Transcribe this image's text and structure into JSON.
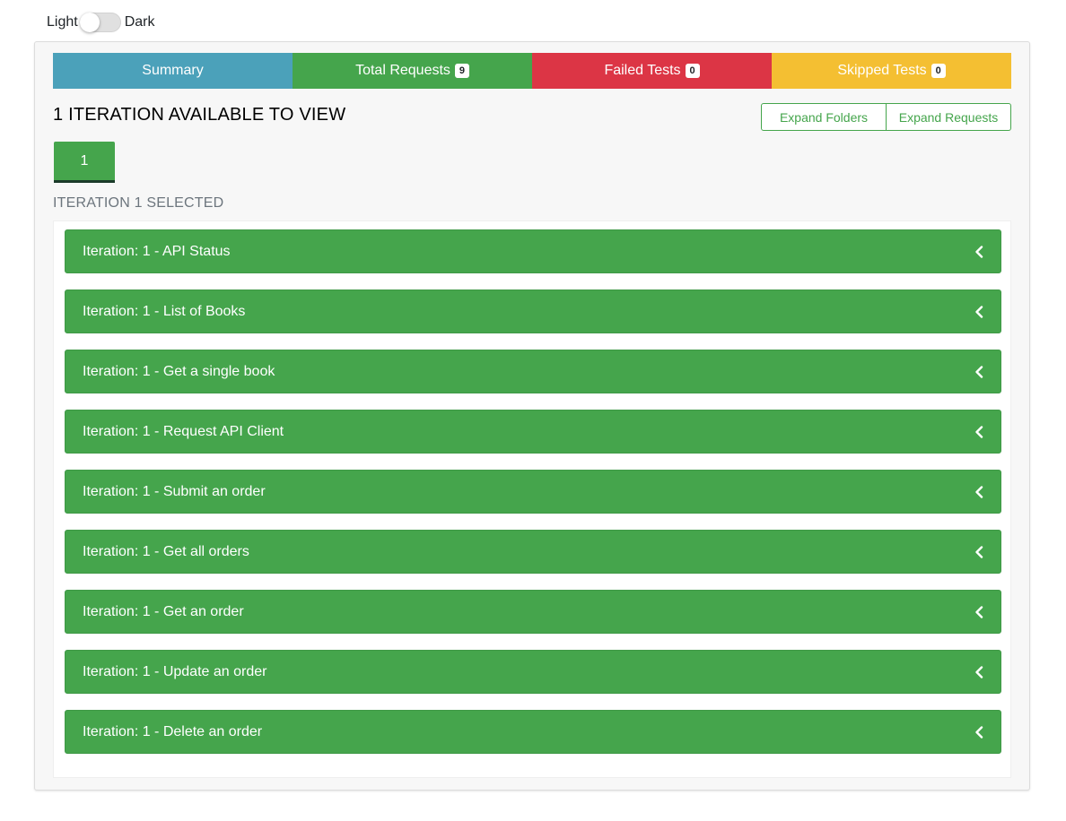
{
  "theme": {
    "light_label": "Light",
    "dark_label": "Dark"
  },
  "tabs": [
    {
      "label": "Summary",
      "badge": null,
      "color": "#4ba1ba"
    },
    {
      "label": "Total Requests",
      "badge": "9",
      "color": "#45a54c"
    },
    {
      "label": "Failed Tests",
      "badge": "0",
      "color": "#dc3545"
    },
    {
      "label": "Skipped Tests",
      "badge": "0",
      "color": "#f4bf32"
    }
  ],
  "iterations": {
    "heading": "1 ITERATION AVAILABLE TO VIEW",
    "expand_folders_label": "Expand Folders",
    "expand_requests_label": "Expand Requests",
    "tab_label": "1",
    "selected_label": "ITERATION 1 SELECTED"
  },
  "requests": [
    {
      "title": "Iteration: 1 - API Status"
    },
    {
      "title": "Iteration: 1 - List of Books"
    },
    {
      "title": "Iteration: 1 - Get a single book"
    },
    {
      "title": "Iteration: 1 - Request API Client"
    },
    {
      "title": "Iteration: 1 - Submit an order"
    },
    {
      "title": "Iteration: 1 - Get all orders"
    },
    {
      "title": "Iteration: 1 - Get an order"
    },
    {
      "title": "Iteration: 1 - Update an order"
    },
    {
      "title": "Iteration: 1 - Delete an order"
    }
  ],
  "colors": {
    "accent_green": "#45a54c"
  }
}
